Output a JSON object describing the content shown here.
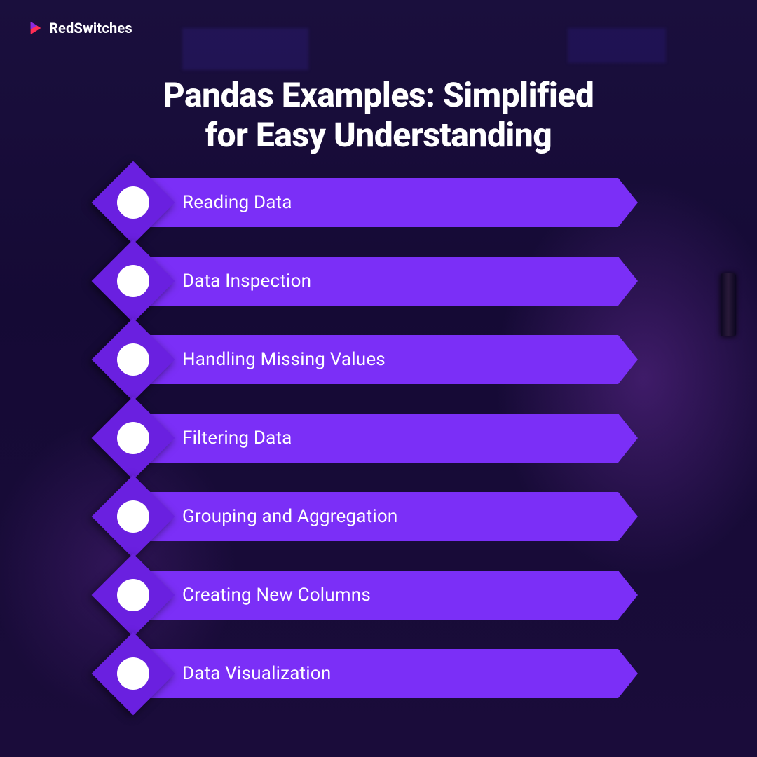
{
  "brand": {
    "name": "RedSwitches"
  },
  "title_line1": "Pandas Examples: Simplified",
  "title_line2": "for Easy Understanding",
  "items": [
    {
      "label": "Reading Data"
    },
    {
      "label": "Data Inspection"
    },
    {
      "label": "Handling Missing Values"
    },
    {
      "label": "Filtering Data"
    },
    {
      "label": "Grouping and Aggregation"
    },
    {
      "label": "Creating New Columns"
    },
    {
      "label": "Data Visualization"
    }
  ],
  "colors": {
    "bar": "#7b2ff7",
    "diamond": "#6a20e0",
    "background": "#1a0f3d"
  }
}
